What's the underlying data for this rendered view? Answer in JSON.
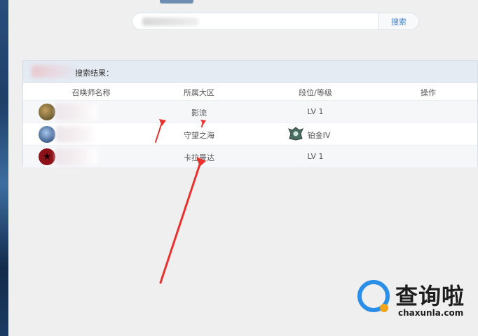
{
  "search": {
    "button_label": "搜索",
    "placeholder": ""
  },
  "results": {
    "title": "搜索结果：",
    "columns": [
      "召唤师名称",
      "所属大区",
      "段位/等级",
      "操作"
    ],
    "rows": [
      {
        "server": "影流",
        "rank": "LV 1",
        "avatar": "summoner-avatar-1"
      },
      {
        "server": "守望之海",
        "rank": "铂金IV",
        "avatar": "summoner-avatar-2",
        "rank_icon": "platinum-rank-icon"
      },
      {
        "server": "卡拉曼达",
        "rank": "LV 1",
        "avatar": "summoner-avatar-3"
      }
    ]
  },
  "watermark": {
    "text": "查询啦",
    "url": "chaxunla.com"
  },
  "colors": {
    "accent": "#3f7fc4",
    "arrow": "#e8322e",
    "header_bg": "#e4ebf3"
  }
}
